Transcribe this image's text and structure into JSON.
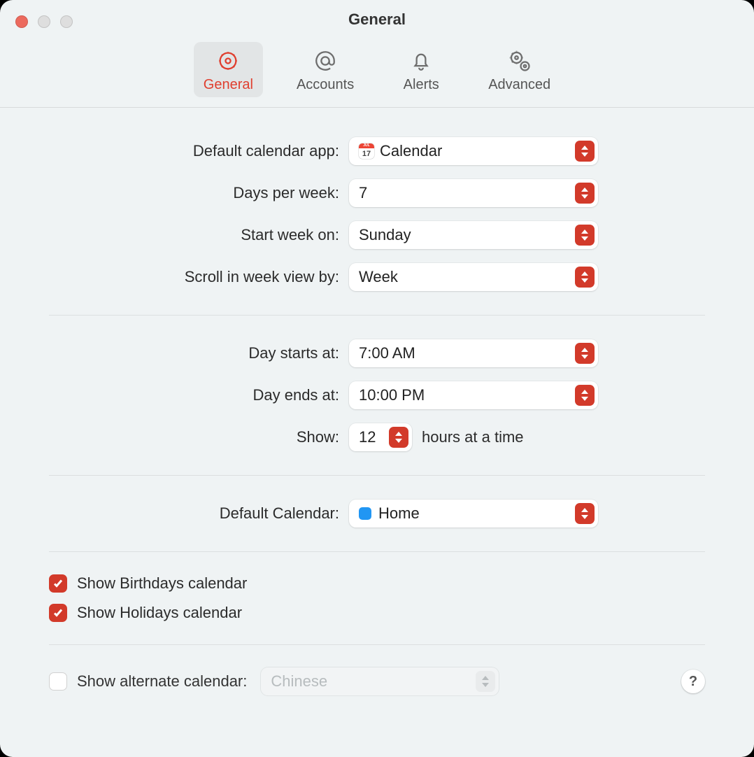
{
  "window_title": "General",
  "toolbar": {
    "tabs": [
      {
        "id": "general",
        "label": "General",
        "selected": true
      },
      {
        "id": "accounts",
        "label": "Accounts",
        "selected": false
      },
      {
        "id": "alerts",
        "label": "Alerts",
        "selected": false
      },
      {
        "id": "advanced",
        "label": "Advanced",
        "selected": false
      }
    ]
  },
  "section1": {
    "default_app_label": "Default calendar app:",
    "default_app_value": "Calendar",
    "calendar_icon_day": "17",
    "calendar_icon_month": "JUL",
    "days_per_week_label": "Days per week:",
    "days_per_week_value": "7",
    "start_week_label": "Start week on:",
    "start_week_value": "Sunday",
    "scroll_label": "Scroll in week view by:",
    "scroll_value": "Week"
  },
  "section2": {
    "day_starts_label": "Day starts at:",
    "day_starts_value": "7:00 AM",
    "day_ends_label": "Day ends at:",
    "day_ends_value": "10:00 PM",
    "show_label": "Show:",
    "show_value": "12",
    "show_suffix": "hours at a time"
  },
  "section3": {
    "default_cal_label": "Default Calendar:",
    "default_cal_value": "Home",
    "default_cal_color": "#2196f3"
  },
  "section4": {
    "birthdays_label": "Show Birthdays calendar",
    "birthdays_checked": true,
    "holidays_label": "Show Holidays calendar",
    "holidays_checked": true
  },
  "section5": {
    "alt_label": "Show alternate calendar:",
    "alt_checked": false,
    "alt_value": "Chinese"
  },
  "help_label": "?"
}
